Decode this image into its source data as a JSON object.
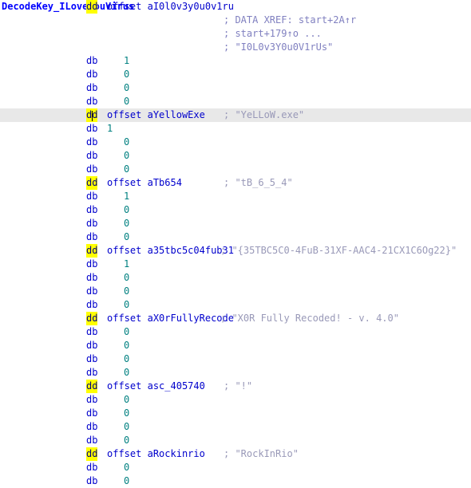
{
  "view": {
    "app": "IDA Pro",
    "view_type": "IDA View-A disassembly listing",
    "background": "#ffffff",
    "highlight_color": "#e8e8e8",
    "token_highlight_color": "#ffff00"
  },
  "tokens": {
    "dd": "dd",
    "db": "db",
    "offset": "offset",
    "semicolon": ";"
  },
  "lines": [
    {
      "kind": "label-dd",
      "name": "DecodeKey_ILoveYouVirus",
      "mnemonic": "dd",
      "keyword": "offset",
      "operand": "aI0l0v3y0u0v1ru",
      "comment": "",
      "highlight": false,
      "cursor": false
    },
    {
      "kind": "comment-only",
      "comment": "; DATA XREF: start+2A↑r"
    },
    {
      "kind": "comment-only",
      "comment": "; start+179↑o ..."
    },
    {
      "kind": "comment-only",
      "comment": "; \"I0L0v3Y0u0V1rUs\""
    },
    {
      "kind": "db",
      "mnemonic": "db",
      "value": "1",
      "tight": false
    },
    {
      "kind": "db",
      "mnemonic": "db",
      "value": "0",
      "tight": false
    },
    {
      "kind": "db",
      "mnemonic": "db",
      "value": "0",
      "tight": false
    },
    {
      "kind": "db",
      "mnemonic": "db",
      "value": "0",
      "tight": false
    },
    {
      "kind": "dd",
      "mnemonic": "dd",
      "keyword": "offset",
      "operand": "aYellowExe",
      "comment": "; \"YeLLoW.exe\"",
      "comment_near": false,
      "highlight": true,
      "cursor": true
    },
    {
      "kind": "db",
      "mnemonic": "db",
      "value": "1",
      "tight": true
    },
    {
      "kind": "db",
      "mnemonic": "db",
      "value": "0",
      "tight": false
    },
    {
      "kind": "db",
      "mnemonic": "db",
      "value": "0",
      "tight": false
    },
    {
      "kind": "db",
      "mnemonic": "db",
      "value": "0",
      "tight": false
    },
    {
      "kind": "dd",
      "mnemonic": "dd",
      "keyword": "offset",
      "operand": "aTb654",
      "comment": "; \"tB_6_5_4\"",
      "comment_near": false,
      "highlight": false,
      "cursor": false
    },
    {
      "kind": "db",
      "mnemonic": "db",
      "value": "1",
      "tight": false
    },
    {
      "kind": "db",
      "mnemonic": "db",
      "value": "0",
      "tight": false
    },
    {
      "kind": "db",
      "mnemonic": "db",
      "value": "0",
      "tight": false
    },
    {
      "kind": "db",
      "mnemonic": "db",
      "value": "0",
      "tight": false
    },
    {
      "kind": "dd",
      "mnemonic": "dd",
      "keyword": "offset",
      "operand": "a35tbc5c04fub31",
      "comment": "; \"{35TBC5C0-4FuB-31XF-AAC4-21CX1C6Og22}\"",
      "comment_near": true,
      "highlight": false,
      "cursor": false
    },
    {
      "kind": "db",
      "mnemonic": "db",
      "value": "1",
      "tight": false
    },
    {
      "kind": "db",
      "mnemonic": "db",
      "value": "0",
      "tight": false
    },
    {
      "kind": "db",
      "mnemonic": "db",
      "value": "0",
      "tight": false
    },
    {
      "kind": "db",
      "mnemonic": "db",
      "value": "0",
      "tight": false
    },
    {
      "kind": "dd",
      "mnemonic": "dd",
      "keyword": "offset",
      "operand": "aX0rFullyRecode",
      "comment": "; \"X0R Fully Recoded! - v. 4.0\"",
      "comment_near": true,
      "highlight": false,
      "cursor": false
    },
    {
      "kind": "db",
      "mnemonic": "db",
      "value": "0",
      "tight": false
    },
    {
      "kind": "db",
      "mnemonic": "db",
      "value": "0",
      "tight": false
    },
    {
      "kind": "db",
      "mnemonic": "db",
      "value": "0",
      "tight": false
    },
    {
      "kind": "db",
      "mnemonic": "db",
      "value": "0",
      "tight": false
    },
    {
      "kind": "dd",
      "mnemonic": "dd",
      "keyword": "offset",
      "operand": "asc_405740",
      "comment": "; \"!\"",
      "comment_near": false,
      "highlight": false,
      "cursor": false
    },
    {
      "kind": "db",
      "mnemonic": "db",
      "value": "0",
      "tight": false
    },
    {
      "kind": "db",
      "mnemonic": "db",
      "value": "0",
      "tight": false
    },
    {
      "kind": "db",
      "mnemonic": "db",
      "value": "0",
      "tight": false
    },
    {
      "kind": "db",
      "mnemonic": "db",
      "value": "0",
      "tight": false
    },
    {
      "kind": "dd",
      "mnemonic": "dd",
      "keyword": "offset",
      "operand": "aRockinrio",
      "comment": "; \"RockInRio\"",
      "comment_near": false,
      "highlight": false,
      "cursor": false
    },
    {
      "kind": "db",
      "mnemonic": "db",
      "value": "0",
      "tight": false
    },
    {
      "kind": "db",
      "mnemonic": "db",
      "value": "0",
      "tight": false
    }
  ]
}
